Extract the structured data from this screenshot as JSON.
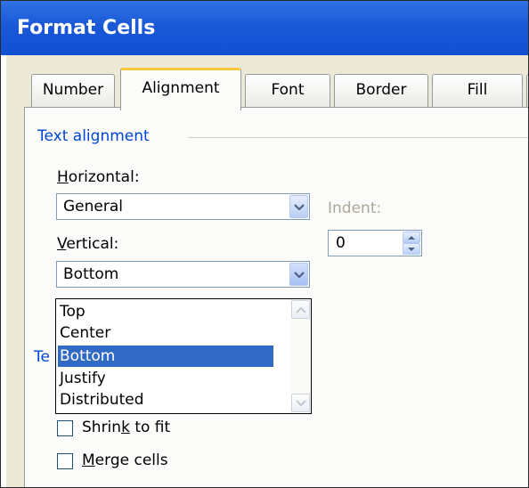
{
  "window": {
    "title": "Format Cells"
  },
  "tabs": [
    {
      "label": "Number",
      "active": false
    },
    {
      "label": "Alignment",
      "active": true
    },
    {
      "label": "Font",
      "active": false
    },
    {
      "label": "Border",
      "active": false
    },
    {
      "label": "Fill",
      "active": false
    }
  ],
  "text_alignment": {
    "group_label": "Text alignment",
    "horizontal_label": "Horizontal:",
    "horizontal_value": "General",
    "indent_label": "Indent:",
    "indent_value": "0",
    "vertical_label": "Vertical:",
    "vertical_value": "Bottom",
    "vertical_options": [
      "Top",
      "Center",
      "Bottom",
      "Justify",
      "Distributed"
    ],
    "vertical_selected": "Bottom"
  },
  "text_control": {
    "group_label_partial": "Te",
    "shrink_to_fit_label": "Shrink to fit",
    "shrink_to_fit_checked": false,
    "merge_cells_label": "Merge cells",
    "merge_cells_checked": false
  },
  "colors": {
    "title_bar": "#1b58d8",
    "group_label": "#0046d5",
    "selection": "#316ac5",
    "active_tab_highlight": "#ffc83c"
  },
  "icons": {
    "combo_arrow": "chevron-down-icon",
    "spin_up": "triangle-up-icon",
    "spin_down": "triangle-down-icon",
    "scroll_up": "chevron-up-icon",
    "scroll_down": "chevron-down-icon"
  }
}
